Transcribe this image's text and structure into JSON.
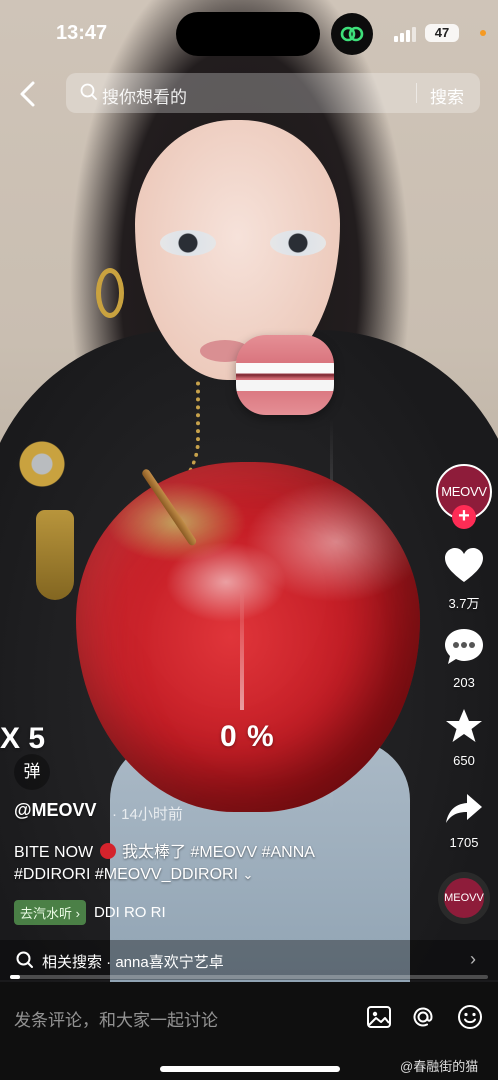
{
  "status_bar": {
    "time": "13:47",
    "battery": "47"
  },
  "search": {
    "placeholder": "搜你想看的",
    "button_label": "搜索"
  },
  "overlay": {
    "multiplier": "X 5",
    "progress_text": "0 %",
    "progress_value": 0
  },
  "rail": {
    "avatar_label": "MEOVV",
    "follow_symbol": "+",
    "like_count": "3.7万",
    "comment_count": "203",
    "favorite_count": "650",
    "share_count": "1705",
    "music_disc_label": "MEOVV"
  },
  "danmaku_label": "弹",
  "post": {
    "author": "@MEOVV",
    "time_ago": "· 14小时前",
    "caption_line1_a": "BITE NOW",
    "caption_line1_b": "我太棒了 #MEOVV #ANNA",
    "caption_line2": "#DDIRORI #MEOVV_DDIRORI",
    "expand_chevron": "⌄",
    "music_tag": "去汽水听 ›",
    "music_name": "DDI RO RI"
  },
  "related": {
    "text": "相关搜索 · anna喜欢宁艺卓",
    "arrow": "›"
  },
  "playback": {
    "progress": 0.02
  },
  "comment": {
    "placeholder": "发条评论，和大家一起讨论"
  },
  "watermark": "@春融街的猫",
  "colors": {
    "accent": "#fe2c55",
    "brand": "#8e1c3a",
    "music_tag": "#5ba154"
  }
}
